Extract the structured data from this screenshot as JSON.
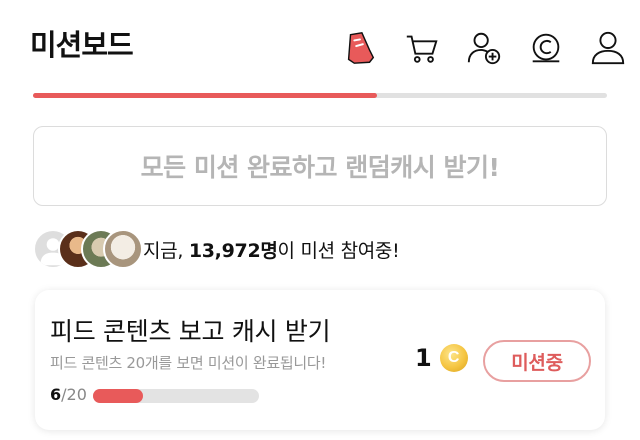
{
  "header": {
    "title": "미션보드",
    "icons": [
      "shoe-icon",
      "cart-icon",
      "add-friend-icon",
      "cash-coin-icon",
      "profile-icon"
    ],
    "accent_color": "#e85a5a"
  },
  "top_progress": {
    "value": 0.6
  },
  "random_cash_button": {
    "label": "모든 미션 완료하고 랜덤캐시 받기!"
  },
  "participants": {
    "prefix": "지금, ",
    "count": "13,972명",
    "suffix": "이 미션 참여중!"
  },
  "mission": {
    "title": "피드 콘텐츠 보고 캐시 받기",
    "description": "피드 콘텐츠 20개를 보면 미션이 완료됩니다!",
    "progress_current": "6",
    "progress_total": "/20",
    "progress_fraction": 0.3,
    "reward_amount": "1",
    "coin_symbol": "C",
    "status_label": "미션중"
  }
}
